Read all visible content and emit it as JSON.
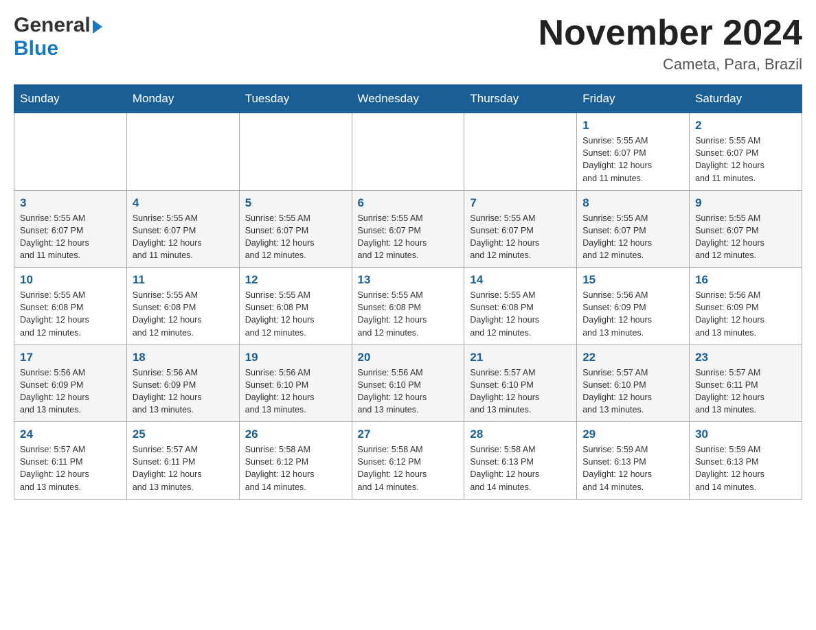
{
  "logo": {
    "general": "General",
    "blue": "Blue"
  },
  "title": "November 2024",
  "location": "Cameta, Para, Brazil",
  "days_of_week": [
    "Sunday",
    "Monday",
    "Tuesday",
    "Wednesday",
    "Thursday",
    "Friday",
    "Saturday"
  ],
  "weeks": [
    [
      {
        "day": "",
        "info": ""
      },
      {
        "day": "",
        "info": ""
      },
      {
        "day": "",
        "info": ""
      },
      {
        "day": "",
        "info": ""
      },
      {
        "day": "",
        "info": ""
      },
      {
        "day": "1",
        "info": "Sunrise: 5:55 AM\nSunset: 6:07 PM\nDaylight: 12 hours\nand 11 minutes."
      },
      {
        "day": "2",
        "info": "Sunrise: 5:55 AM\nSunset: 6:07 PM\nDaylight: 12 hours\nand 11 minutes."
      }
    ],
    [
      {
        "day": "3",
        "info": "Sunrise: 5:55 AM\nSunset: 6:07 PM\nDaylight: 12 hours\nand 11 minutes."
      },
      {
        "day": "4",
        "info": "Sunrise: 5:55 AM\nSunset: 6:07 PM\nDaylight: 12 hours\nand 11 minutes."
      },
      {
        "day": "5",
        "info": "Sunrise: 5:55 AM\nSunset: 6:07 PM\nDaylight: 12 hours\nand 12 minutes."
      },
      {
        "day": "6",
        "info": "Sunrise: 5:55 AM\nSunset: 6:07 PM\nDaylight: 12 hours\nand 12 minutes."
      },
      {
        "day": "7",
        "info": "Sunrise: 5:55 AM\nSunset: 6:07 PM\nDaylight: 12 hours\nand 12 minutes."
      },
      {
        "day": "8",
        "info": "Sunrise: 5:55 AM\nSunset: 6:07 PM\nDaylight: 12 hours\nand 12 minutes."
      },
      {
        "day": "9",
        "info": "Sunrise: 5:55 AM\nSunset: 6:07 PM\nDaylight: 12 hours\nand 12 minutes."
      }
    ],
    [
      {
        "day": "10",
        "info": "Sunrise: 5:55 AM\nSunset: 6:08 PM\nDaylight: 12 hours\nand 12 minutes."
      },
      {
        "day": "11",
        "info": "Sunrise: 5:55 AM\nSunset: 6:08 PM\nDaylight: 12 hours\nand 12 minutes."
      },
      {
        "day": "12",
        "info": "Sunrise: 5:55 AM\nSunset: 6:08 PM\nDaylight: 12 hours\nand 12 minutes."
      },
      {
        "day": "13",
        "info": "Sunrise: 5:55 AM\nSunset: 6:08 PM\nDaylight: 12 hours\nand 12 minutes."
      },
      {
        "day": "14",
        "info": "Sunrise: 5:55 AM\nSunset: 6:08 PM\nDaylight: 12 hours\nand 12 minutes."
      },
      {
        "day": "15",
        "info": "Sunrise: 5:56 AM\nSunset: 6:09 PM\nDaylight: 12 hours\nand 13 minutes."
      },
      {
        "day": "16",
        "info": "Sunrise: 5:56 AM\nSunset: 6:09 PM\nDaylight: 12 hours\nand 13 minutes."
      }
    ],
    [
      {
        "day": "17",
        "info": "Sunrise: 5:56 AM\nSunset: 6:09 PM\nDaylight: 12 hours\nand 13 minutes."
      },
      {
        "day": "18",
        "info": "Sunrise: 5:56 AM\nSunset: 6:09 PM\nDaylight: 12 hours\nand 13 minutes."
      },
      {
        "day": "19",
        "info": "Sunrise: 5:56 AM\nSunset: 6:10 PM\nDaylight: 12 hours\nand 13 minutes."
      },
      {
        "day": "20",
        "info": "Sunrise: 5:56 AM\nSunset: 6:10 PM\nDaylight: 12 hours\nand 13 minutes."
      },
      {
        "day": "21",
        "info": "Sunrise: 5:57 AM\nSunset: 6:10 PM\nDaylight: 12 hours\nand 13 minutes."
      },
      {
        "day": "22",
        "info": "Sunrise: 5:57 AM\nSunset: 6:10 PM\nDaylight: 12 hours\nand 13 minutes."
      },
      {
        "day": "23",
        "info": "Sunrise: 5:57 AM\nSunset: 6:11 PM\nDaylight: 12 hours\nand 13 minutes."
      }
    ],
    [
      {
        "day": "24",
        "info": "Sunrise: 5:57 AM\nSunset: 6:11 PM\nDaylight: 12 hours\nand 13 minutes."
      },
      {
        "day": "25",
        "info": "Sunrise: 5:57 AM\nSunset: 6:11 PM\nDaylight: 12 hours\nand 13 minutes."
      },
      {
        "day": "26",
        "info": "Sunrise: 5:58 AM\nSunset: 6:12 PM\nDaylight: 12 hours\nand 14 minutes."
      },
      {
        "day": "27",
        "info": "Sunrise: 5:58 AM\nSunset: 6:12 PM\nDaylight: 12 hours\nand 14 minutes."
      },
      {
        "day": "28",
        "info": "Sunrise: 5:58 AM\nSunset: 6:13 PM\nDaylight: 12 hours\nand 14 minutes."
      },
      {
        "day": "29",
        "info": "Sunrise: 5:59 AM\nSunset: 6:13 PM\nDaylight: 12 hours\nand 14 minutes."
      },
      {
        "day": "30",
        "info": "Sunrise: 5:59 AM\nSunset: 6:13 PM\nDaylight: 12 hours\nand 14 minutes."
      }
    ]
  ]
}
